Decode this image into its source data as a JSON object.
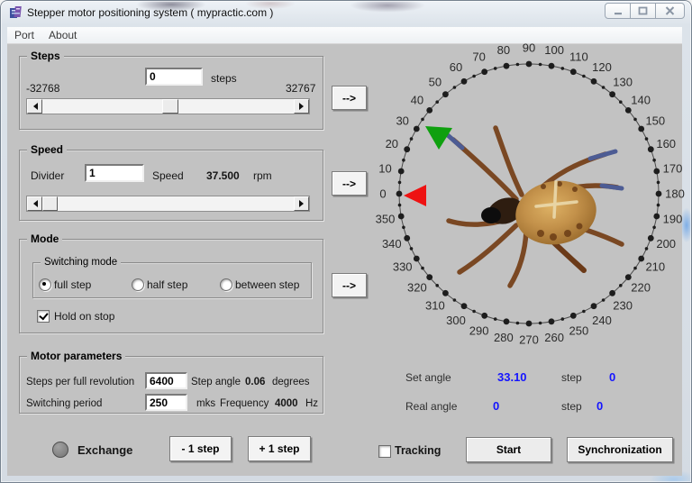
{
  "window": {
    "title": "Stepper motor positioning system ( mypractic.com )",
    "menu": [
      "Port",
      "About"
    ]
  },
  "steps": {
    "legend": "Steps",
    "value": "0",
    "unit": "steps",
    "min": "-32768",
    "max": "32767"
  },
  "speed": {
    "legend": "Speed",
    "divider_label": "Divider",
    "divider_value": "1",
    "speed_label": "Speed",
    "speed_value": "37.500",
    "unit": "rpm"
  },
  "mode": {
    "legend": "Mode",
    "switching_legend": "Switching mode",
    "options": [
      "full step",
      "half step",
      "between step"
    ],
    "selected": "full step",
    "hold_label": "Hold on stop",
    "hold_checked": true
  },
  "motor": {
    "legend": "Motor parameters",
    "revolution_label": "Steps per full revolution",
    "revolution_value": "6400",
    "step_angle_label": "Step angle",
    "step_angle_value": "0.06",
    "step_angle_unit": "degrees",
    "period_label": "Switching period",
    "period_value": "250",
    "period_unit": "mks",
    "frequency_label": "Frequency",
    "frequency_value": "4000",
    "frequency_unit": "Hz"
  },
  "actions": {
    "exchange_label": "Exchange",
    "minus_step": "- 1 step",
    "plus_step": "+ 1 step",
    "tracking_label": "Tracking",
    "tracking_checked": false,
    "start": "Start",
    "sync": "Synchronization",
    "arrow": "-->"
  },
  "dial": {
    "labels": [
      "0",
      "10",
      "20",
      "30",
      "40",
      "50",
      "60",
      "70",
      "80",
      "90",
      "100",
      "110",
      "120",
      "130",
      "140",
      "150",
      "160",
      "170",
      "180",
      "190",
      "200",
      "210",
      "220",
      "230",
      "240",
      "250",
      "260",
      "270",
      "280",
      "290",
      "300",
      "310",
      "320",
      "330",
      "340",
      "350"
    ],
    "set_angle": 33.1,
    "real_angle": 0,
    "set_marker_color": "#0fa00f",
    "real_marker_color": "#ee1212"
  },
  "readout": {
    "set_label": "Set angle",
    "set_value": "33.10",
    "set_step_label": "step",
    "set_step_value": "0",
    "real_label": "Real angle",
    "real_value": "0",
    "real_step_label": "step",
    "real_step_value": "0",
    "value_color": "#1414ff"
  }
}
